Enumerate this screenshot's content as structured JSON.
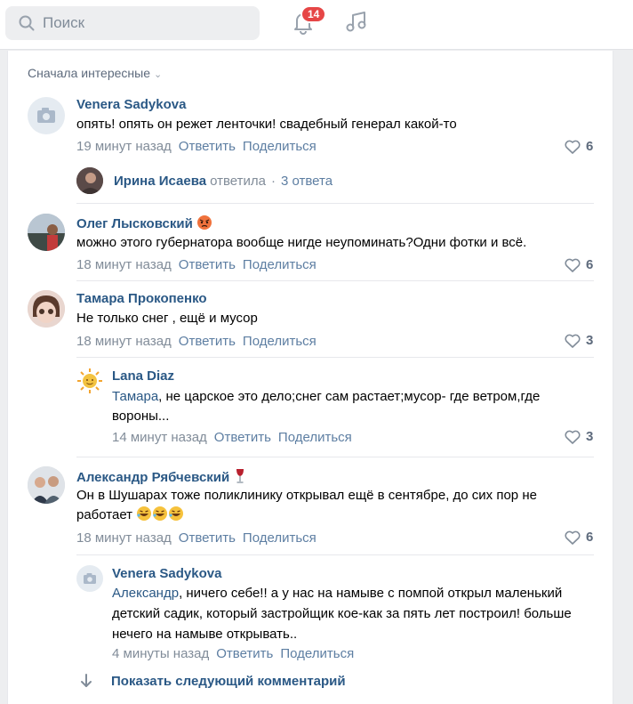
{
  "header": {
    "search_placeholder": "Поиск",
    "notifications_count": "14"
  },
  "sort_label": "Сначала интересные",
  "comments": [
    {
      "author": "Venera Sadykova",
      "text": "опять! опять он режет ленточки! свадебный генерал какой-то",
      "time": "19 минут назад",
      "likes": "6",
      "thread": {
        "author": "Ирина Исаева",
        "action": "ответила",
        "count": "3 ответа"
      }
    },
    {
      "author": "Олег Лысковский",
      "text": "можно этого губернатора вообще нигде неупоминать?Одни фотки и всё.",
      "time": "18 минут назад",
      "likes": "6"
    },
    {
      "author": "Тамара Прокопенко",
      "text": "Не только снег , ещё и мусор",
      "time": "18 минут назад",
      "likes": "3",
      "reply": {
        "author": "Lana Diaz",
        "mention": "Тамара",
        "text": ", не царское это дело;снег сам растает;мусор- где ветром,где вороны...",
        "time": "14 минут назад",
        "likes": "3"
      }
    },
    {
      "author": "Александр Рябчевский",
      "text": "Он в Шушарах тоже поликлинику открывал ещё в сентябре, до сих пор не работает",
      "time": "18 минут назад",
      "likes": "6",
      "reply": {
        "author": "Venera Sadykova",
        "mention": "Александр",
        "text": ", ничего себе!! а у нас на намыве с помпой открыл маленький детский садик, который застройщик кое-как за пять лет построил! больше нечего на намыве открывать..",
        "time": "4 минуты назад"
      }
    }
  ],
  "actions": {
    "reply": "Ответить",
    "share": "Поделиться"
  },
  "show_next": "Показать следующий комментарий"
}
